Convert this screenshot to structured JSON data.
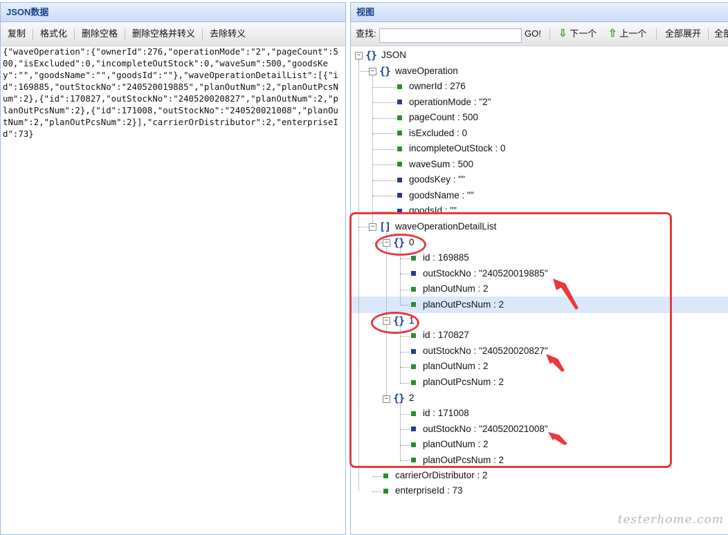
{
  "left_panel": {
    "title": "JSON数据",
    "toolbar": [
      "复制",
      "格式化",
      "删除空格",
      "删除空格并转义",
      "去除转义"
    ],
    "json_text": "{\"waveOperation\":{\"ownerId\":276,\"operationMode\":\"2\",\"pageCount\":500,\"isExcluded\":0,\"incompleteOutStock\":0,\"waveSum\":500,\"goodsKey\":\"\",\"goodsName\":\"\",\"goodsId\":\"\"},\"waveOperationDetailList\":[{\"id\":169885,\"outStockNo\":\"240520019885\",\"planOutNum\":2,\"planOutPcsNum\":2},{\"id\":170827,\"outStockNo\":\"240520020827\",\"planOutNum\":2,\"planOutPcsNum\":2},{\"id\":171008,\"outStockNo\":\"240520021008\",\"planOutNum\":2,\"planOutPcsNum\":2}],\"carrierOrDistributor\":2,\"enterpriseId\":73}"
  },
  "right_panel": {
    "title": "视图",
    "search_label": "查找:",
    "search_value": "",
    "go_label": "GO!",
    "next_label": "下一个",
    "prev_label": "上一个",
    "expand_all_label": "全部展开",
    "collapse_all_label": "全部"
  },
  "tree": {
    "root": "JSON",
    "wave_operation": {
      "label": "waveOperation",
      "fields": [
        "ownerId : 276",
        "operationMode : \"2\"",
        "pageCount : 500",
        "isExcluded : 0",
        "incompleteOutStock : 0",
        "waveSum : 500",
        "goodsKey : \"\"",
        "goodsName : \"\"",
        "goodsId : \"\""
      ]
    },
    "detail_list": {
      "label": "waveOperationDetailList",
      "items": [
        {
          "index": "0",
          "fields": [
            "id : 169885",
            "outStockNo : \"240520019885\"",
            "planOutNum : 2",
            "planOutPcsNum : 2"
          ]
        },
        {
          "index": "1",
          "fields": [
            "id : 170827",
            "outStockNo : \"240520020827\"",
            "planOutNum : 2",
            "planOutPcsNum : 2"
          ]
        },
        {
          "index": "2",
          "fields": [
            "id : 171008",
            "outStockNo : \"240520021008\"",
            "planOutNum : 2",
            "planOutPcsNum : 2"
          ]
        }
      ]
    },
    "tail_fields": [
      "carrierOrDistributor : 2",
      "enterpriseId : 73"
    ]
  },
  "watermark": "testerhome.com",
  "colors": {
    "annotation_red": "#e8383d",
    "header_blue": "#15428b",
    "leaf_number": "#2e8b2e",
    "leaf_string": "#2a3c8a",
    "selected_row": "#dbe8fb"
  }
}
